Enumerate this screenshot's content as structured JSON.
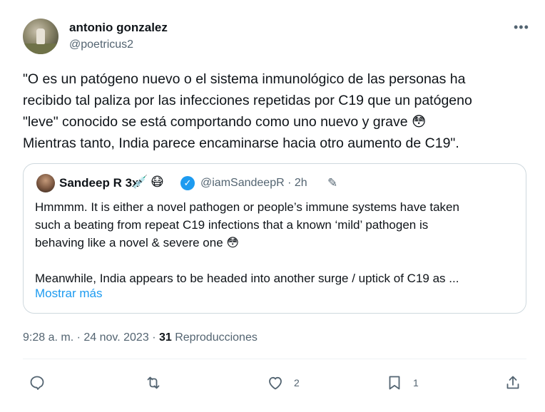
{
  "post": {
    "author_name": "antonio gonzalez",
    "author_handle": "@poetricus2",
    "more_label": "•••",
    "text_lines": [
      "\"O es un patógeno nuevo o el sistema inmunológico de las personas ha",
      "recibido tal paliza por las infecciones repetidas por C19 que un patógeno",
      "\"leve\" conocido se está comportando como uno nuevo y grave 😳",
      "Mientras tanto, India parece encaminarse hacia otro aumento de C19\"."
    ],
    "time": "9:28 a. m.",
    "date": "24 nov. 2023",
    "views_count": "31",
    "views_label": "Reproducciones"
  },
  "quote": {
    "author_name": "Sandeep R 3x",
    "name_emojis": [
      "💉",
      "😷"
    ],
    "author_handle": "@iamSandeepR",
    "time": "2h",
    "body_lines": [
      "Hmmmm. It is either a novel pathogen or people’s immune systems have taken",
      "such a beating from repeat C19 infections that a known ‘mild’ pathogen is",
      "behaving like a novel & severe one 😳",
      "",
      "Meanwhile, India appears to be headed into another surge / uptick of C19 as ..."
    ],
    "show_more": "Mostrar más"
  },
  "actions": {
    "reply_icon": "reply-icon",
    "repost_icon": "repost-icon",
    "like_icon": "like-icon",
    "like_count": "2",
    "bookmark_icon": "bookmark-icon",
    "bookmark_count": "1",
    "share_icon": "share-icon"
  },
  "colors": {
    "accent": "#1d9bf0",
    "secondary_text": "#536471",
    "border": "#cfd9de"
  }
}
